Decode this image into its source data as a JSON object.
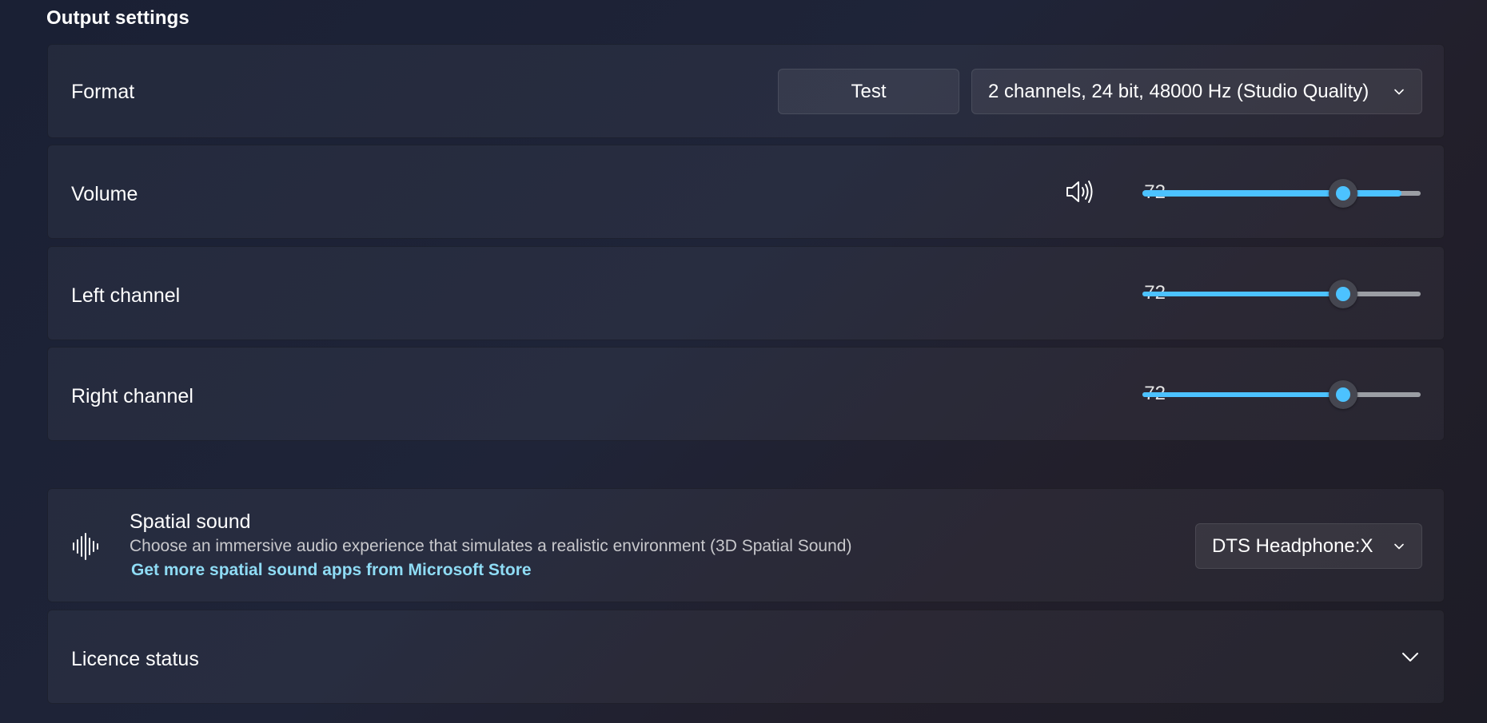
{
  "section": {
    "title": "Output settings"
  },
  "format": {
    "label": "Format",
    "test_label": "Test",
    "selected": "2 channels, 24 bit, 48000 Hz (Studio Quality)"
  },
  "volume": {
    "label": "Volume",
    "icon": "speaker-icon",
    "value": "72",
    "level": 0.72,
    "peak": 0.93
  },
  "left_channel": {
    "label": "Left channel",
    "value": "72",
    "level": 0.72
  },
  "right_channel": {
    "label": "Right channel",
    "value": "72",
    "level": 0.72
  },
  "spatial": {
    "icon": "sound-wave-icon",
    "title": "Spatial sound",
    "description": "Choose an immersive audio experience that simulates a realistic environment (3D Spatial Sound)",
    "link": "Get more spatial sound apps from Microsoft Store",
    "selected": "DTS Headphone:X"
  },
  "licence": {
    "label": "Licence status"
  },
  "colors": {
    "accent": "#4cc2ff",
    "link": "#8fdcf5",
    "track": "#9b9ea4"
  }
}
